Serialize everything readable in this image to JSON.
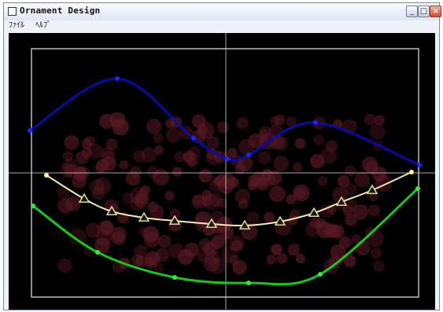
{
  "window": {
    "title": "Ornament Design",
    "icon": "window-app-icon",
    "controls": {
      "minimize": "_",
      "maximize": "□",
      "close": "×"
    }
  },
  "menu": {
    "items": [
      {
        "label": "ﾌｧｲﾙ"
      },
      {
        "label": "ﾍﾙﾌﾟ"
      }
    ]
  },
  "colors": {
    "background": "#000000",
    "frame": "#e8e8e8",
    "crosshair": "#cfcfcf",
    "top_curve": "#0a0aa8",
    "middle_curve": "#f2e8b4",
    "bottom_curve": "#18c818",
    "ornament": "#5a1a24",
    "marker_outline": "#f0e6a8"
  }
}
